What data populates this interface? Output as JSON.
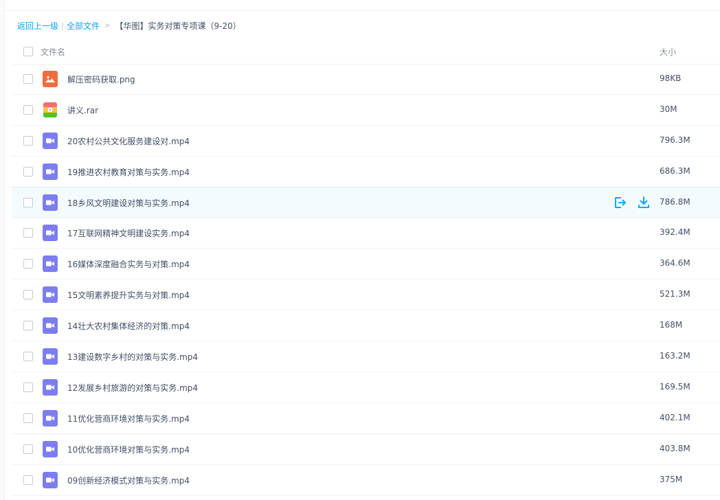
{
  "breadcrumb": {
    "back": "返回上一级",
    "separator": "|",
    "all_files": "全部文件",
    "arrow": ">",
    "current": "【华图】实务对策专项课（9-20）"
  },
  "header": {
    "name_col": "文件名",
    "size_col": "大小"
  },
  "files": [
    {
      "name": "解压密码获取.png",
      "size": "98KB",
      "icon": "image-file-icon"
    },
    {
      "name": "讲义.rar",
      "size": "30M",
      "icon": "archive-file-icon"
    },
    {
      "name": "20农村公共文化服务建设对.mp4",
      "size": "796.3M",
      "icon": "video-file-icon"
    },
    {
      "name": "19推进农村教育对策与实务.mp4",
      "size": "686.3M",
      "icon": "video-file-icon"
    },
    {
      "name": "18乡风文明建设对策与实务.mp4",
      "size": "786.8M",
      "icon": "video-file-icon"
    },
    {
      "name": "17互联网精神文明建设实务.mp4",
      "size": "392.4M",
      "icon": "video-file-icon"
    },
    {
      "name": "16媒体深度融合实务与对策.mp4",
      "size": "364.6M",
      "icon": "video-file-icon"
    },
    {
      "name": "15文明素养提升实务与对策.mp4",
      "size": "521.3M",
      "icon": "video-file-icon"
    },
    {
      "name": "14壮大农村集体经济的对策.mp4",
      "size": "168M",
      "icon": "video-file-icon"
    },
    {
      "name": "13建设数字乡村的对策与实务.mp4",
      "size": "163.2M",
      "icon": "video-file-icon"
    },
    {
      "name": "12发展乡村旅游的对策与实务.mp4",
      "size": "169.5M",
      "icon": "video-file-icon"
    },
    {
      "name": "11优化营商环境对策与实务.mp4",
      "size": "402.1M",
      "icon": "video-file-icon"
    },
    {
      "name": "10优化营商环境对策与实务.mp4",
      "size": "403.8M",
      "icon": "video-file-icon"
    },
    {
      "name": "09创新经济模式对策与实务.mp4",
      "size": "375M",
      "icon": "video-file-icon"
    }
  ],
  "hovered_row": 4,
  "row_actions": [
    "share-icon",
    "download-icon"
  ],
  "colors": {
    "accent": "#06a7ff",
    "video_icon": "#7c7ef0",
    "image_icon": "#f36c3d",
    "hover_row": "#f4fbff"
  }
}
